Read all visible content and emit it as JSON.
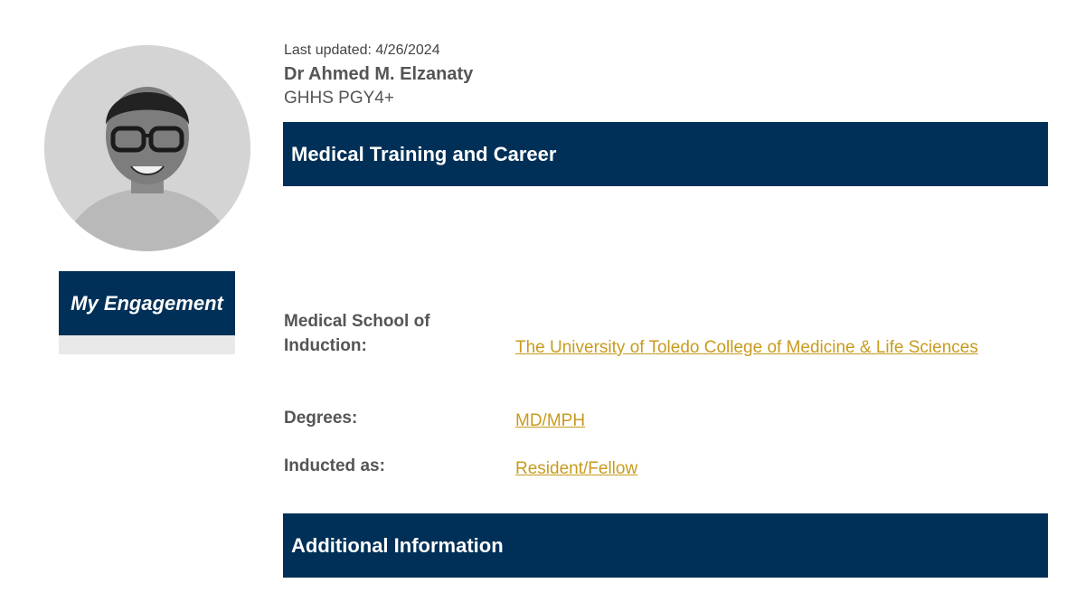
{
  "profile": {
    "last_updated": "Last updated: 4/26/2024",
    "name": "Dr Ahmed M. Elzanaty",
    "role": "GHHS PGY4+",
    "photo_icon": "profile-photo"
  },
  "sidebar": {
    "engagement_label": "My Engagement"
  },
  "sections": {
    "training_title": "Medical Training and Career",
    "additional_title": "Additional Information"
  },
  "fields": {
    "school_label": "Medical School of Induction:",
    "school_value": "The University of Toledo College of Medicine & Life Sciences",
    "degrees_label": "Degrees:",
    "degrees_value": "MD/MPH",
    "inducted_label": "Inducted as:",
    "inducted_value": "Resident/Fellow"
  },
  "colors": {
    "navy": "#003057",
    "link_gold": "#c89b1e",
    "text_gray": "#555555"
  }
}
